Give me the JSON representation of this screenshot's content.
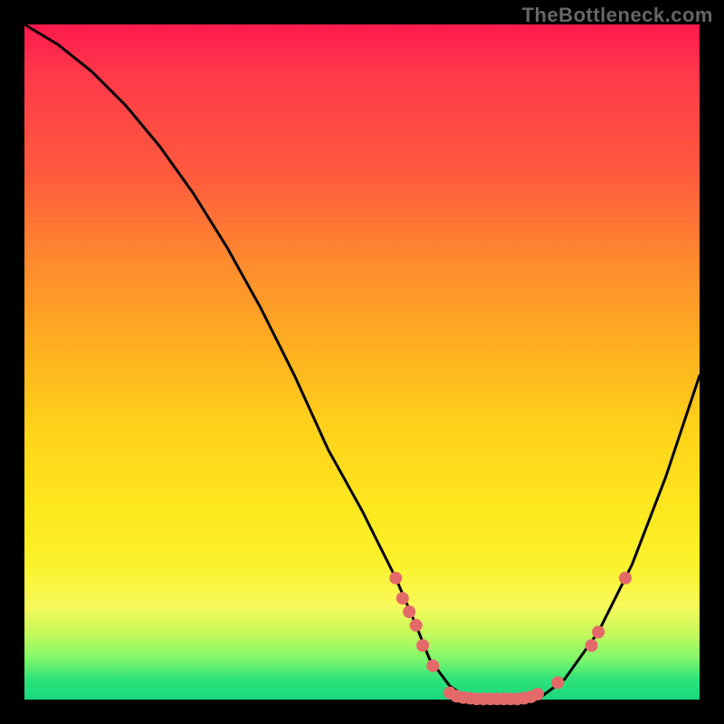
{
  "watermark": "TheBottleneck.com",
  "chart_data": {
    "type": "line",
    "title": "",
    "xlabel": "",
    "ylabel": "",
    "xlim": [
      0,
      100
    ],
    "ylim": [
      0,
      100
    ],
    "grid": false,
    "series": [
      {
        "name": "bottleneck-curve",
        "color": "#000000",
        "x": [
          0,
          5,
          10,
          15,
          20,
          25,
          30,
          35,
          40,
          45,
          50,
          52,
          55,
          58,
          60,
          63,
          66,
          70,
          73,
          76,
          80,
          85,
          90,
          95,
          100
        ],
        "y": [
          100,
          97,
          93,
          88,
          82,
          75,
          67,
          58,
          48,
          37,
          28,
          24,
          18,
          11,
          6,
          2,
          0,
          0,
          0,
          0,
          3,
          10,
          20,
          33,
          48
        ]
      }
    ],
    "markers": {
      "name": "highlighted-points",
      "color": "#e46a6a",
      "radius_px": 7,
      "points": [
        {
          "x": 55,
          "y": 18
        },
        {
          "x": 56,
          "y": 15
        },
        {
          "x": 57,
          "y": 13
        },
        {
          "x": 58,
          "y": 11
        },
        {
          "x": 59,
          "y": 8
        },
        {
          "x": 60.5,
          "y": 5
        },
        {
          "x": 63,
          "y": 1
        },
        {
          "x": 64,
          "y": 0.5
        },
        {
          "x": 65,
          "y": 0.3
        },
        {
          "x": 66,
          "y": 0.2
        },
        {
          "x": 67,
          "y": 0.1
        },
        {
          "x": 68,
          "y": 0.1
        },
        {
          "x": 69,
          "y": 0.1
        },
        {
          "x": 70,
          "y": 0.1
        },
        {
          "x": 71,
          "y": 0.1
        },
        {
          "x": 72,
          "y": 0.1
        },
        {
          "x": 73,
          "y": 0.1
        },
        {
          "x": 74,
          "y": 0.2
        },
        {
          "x": 75,
          "y": 0.4
        },
        {
          "x": 76,
          "y": 0.8
        },
        {
          "x": 79,
          "y": 2.5
        },
        {
          "x": 84,
          "y": 8
        },
        {
          "x": 85,
          "y": 10
        },
        {
          "x": 89,
          "y": 18
        }
      ]
    },
    "gradient_colors": {
      "top": "#ff1a4d",
      "mid1": "#ff8a2e",
      "mid2": "#fde81e",
      "bottom": "#19d87d"
    }
  }
}
